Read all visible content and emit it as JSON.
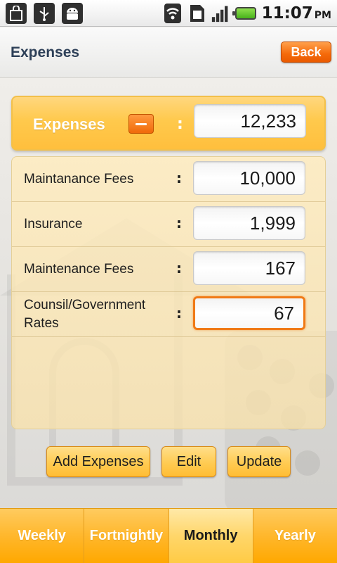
{
  "status_bar": {
    "time": "11:07",
    "ampm": "PM",
    "icons": [
      "bag-icon",
      "usb-icon",
      "android-icon",
      "wifi-icon",
      "sim-icon",
      "signal-icon",
      "battery-icon"
    ]
  },
  "header": {
    "title": "Expenses",
    "back_label": "Back"
  },
  "total": {
    "label": "Expenses",
    "colon": ":",
    "value": "12,233"
  },
  "items": [
    {
      "label": "Maintanance Fees",
      "value": "10,000"
    },
    {
      "label": "Insurance",
      "value": "1,999"
    },
    {
      "label": "Maintenance Fees",
      "value": "167"
    },
    {
      "label": "Counsil/Government Rates",
      "value": "67",
      "focused": true
    }
  ],
  "item_colon": ":",
  "actions": {
    "add_label": "Add Expenses",
    "edit_label": "Edit",
    "update_label": "Update"
  },
  "tabs": [
    {
      "label": "Weekly"
    },
    {
      "label": "Fortnightly"
    },
    {
      "label": "Monthly",
      "active": true
    },
    {
      "label": "Yearly"
    }
  ],
  "colors": {
    "accent": "#f56a0a",
    "gold": "#ffc94c",
    "title_blue": "#2e4058"
  }
}
